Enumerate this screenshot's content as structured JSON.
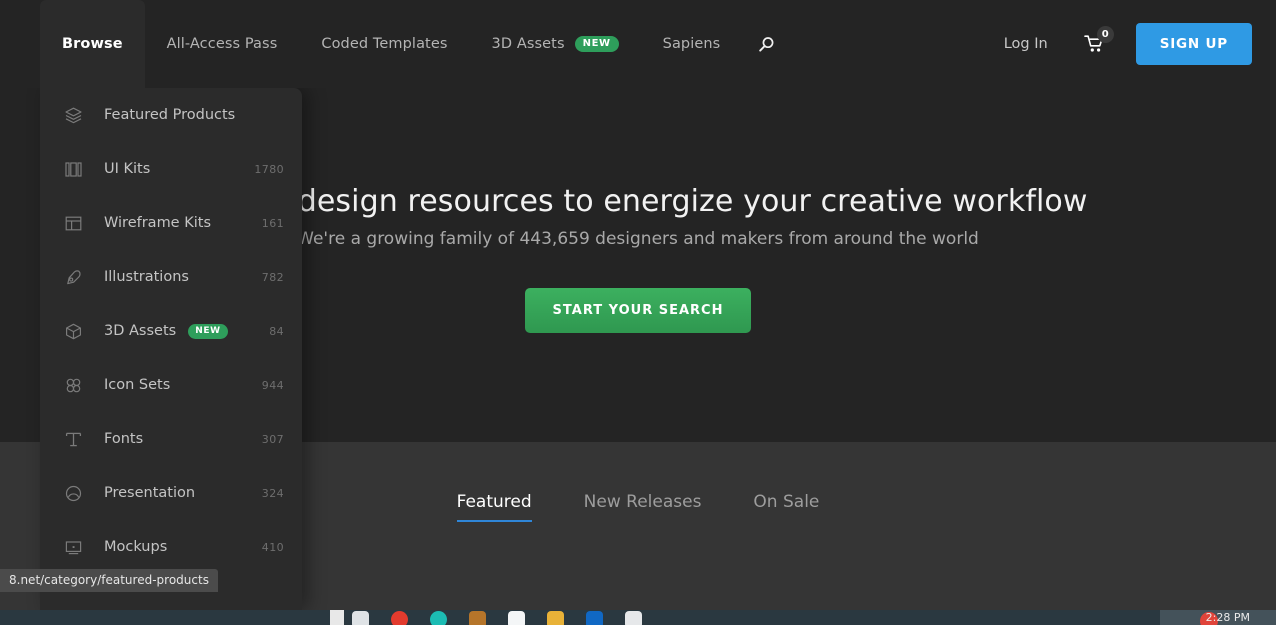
{
  "header": {
    "nav_items": [
      {
        "label": "Browse",
        "active": true,
        "badge": null
      },
      {
        "label": "All-Access Pass",
        "active": false,
        "badge": null
      },
      {
        "label": "Coded Templates",
        "active": false,
        "badge": null
      },
      {
        "label": "3D Assets",
        "active": false,
        "badge": "NEW"
      },
      {
        "label": "Sapiens",
        "active": false,
        "badge": null
      }
    ],
    "search_icon": "search-icon",
    "login_label": "Log In",
    "cart_icon": "shopping-cart-icon",
    "cart_count": "0",
    "signup_label": "SIGN UP",
    "signup_color": "#2f9ae4"
  },
  "hero": {
    "title": "urated design resources to energize your creative workflow",
    "subtitle": "We're a growing family of 443,659 designers and makers from around the world",
    "cta_label": "START YOUR SEARCH",
    "cta_color": "#35a457"
  },
  "content": {
    "tabs": [
      {
        "label": "Featured",
        "active": true
      },
      {
        "label": "New Releases",
        "active": false
      },
      {
        "label": "On Sale",
        "active": false
      }
    ],
    "active_tab_underline_color": "#2f86d8"
  },
  "dropdown": {
    "items": [
      {
        "label": "Featured Products",
        "count": "",
        "badge": null,
        "icon": "layers-icon"
      },
      {
        "label": "UI Kits",
        "count": "1780",
        "badge": null,
        "icon": "ui-kit-icon"
      },
      {
        "label": "Wireframe Kits",
        "count": "161",
        "badge": null,
        "icon": "wireframe-icon"
      },
      {
        "label": "Illustrations",
        "count": "782",
        "badge": null,
        "icon": "pen-nib-icon"
      },
      {
        "label": "3D Assets",
        "count": "84",
        "badge": "NEW",
        "icon": "cube-icon"
      },
      {
        "label": "Icon Sets",
        "count": "944",
        "badge": null,
        "icon": "icon-set-icon"
      },
      {
        "label": "Fonts",
        "count": "307",
        "badge": null,
        "icon": "typography-icon"
      },
      {
        "label": "Presentation",
        "count": "324",
        "badge": null,
        "icon": "presentation-icon"
      },
      {
        "label": "Mockups",
        "count": "410",
        "badge": null,
        "icon": "mockup-icon"
      }
    ],
    "badge_color": "#2e9e5b"
  },
  "statusbar": {
    "url": "8.net/category/featured-products"
  },
  "taskbar": {
    "clock": "2:28 PM"
  }
}
